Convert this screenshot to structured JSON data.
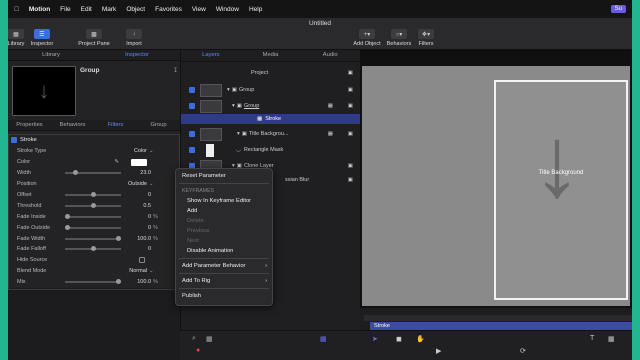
{
  "menubar": {
    "app": "Motion",
    "items": [
      "File",
      "Edit",
      "Mark",
      "Object",
      "Favorites",
      "View",
      "Window",
      "Help"
    ],
    "badge": "Su"
  },
  "window": {
    "title": "Untitled"
  },
  "toolbar": {
    "library": "Library",
    "inspector": "Inspector",
    "project_pane": "Project Pane",
    "import": "Import",
    "add_object": "Add Object",
    "behaviors": "Behaviors",
    "filters": "Filters"
  },
  "left_tabs": {
    "library": "Library",
    "inspector": "Inspector"
  },
  "inspector": {
    "name": "Group",
    "tabs": [
      "Properties",
      "Behaviors",
      "Filters",
      "Group"
    ]
  },
  "stroke": {
    "title": "Stroke",
    "rows": [
      {
        "label": "Stroke Type",
        "value": "Color",
        "unit": ""
      },
      {
        "label": "Color",
        "value": "",
        "unit": ""
      },
      {
        "label": "Width",
        "value": "23.0",
        "unit": ""
      },
      {
        "label": "Position",
        "value": "Outside",
        "unit": ""
      },
      {
        "label": "Offset",
        "value": "0",
        "unit": ""
      },
      {
        "label": "Threshold",
        "value": "0.5",
        "unit": ""
      },
      {
        "label": "Fade Inside",
        "value": "0",
        "unit": "%"
      },
      {
        "label": "Fade Outside",
        "value": "0",
        "unit": "%"
      },
      {
        "label": "Fade Width",
        "value": "100.0",
        "unit": "%"
      },
      {
        "label": "Fade Falloff",
        "value": "0",
        "unit": ""
      },
      {
        "label": "Hide Source",
        "value": "",
        "unit": ""
      },
      {
        "label": "Blend Mode",
        "value": "Normal",
        "unit": ""
      },
      {
        "label": "Mix",
        "value": "100.0",
        "unit": "%"
      }
    ]
  },
  "layer_tabs": {
    "layers": "Layers",
    "media": "Media",
    "audio": "Audio"
  },
  "layers": {
    "project": "Project",
    "group": "Group",
    "group2": "Group",
    "stroke": "Stroke",
    "title_bg": "Title Backgrou...",
    "rect_mask": "Rectangle Mask",
    "clone": "Clone Layer",
    "gauss": "ssian Blur"
  },
  "context_menu": {
    "reset": "Reset Parameter",
    "keyframes": "KEYFRAMES",
    "show_kf": "Show In Keyframe Editor",
    "add": "Add",
    "delete": "Delete",
    "previous": "Previous",
    "next": "Next",
    "disable": "Disable Animation",
    "add_param_behavior": "Add Parameter Behavior",
    "add_to_rig": "Add To Rig",
    "publish": "Publish"
  },
  "canvas": {
    "title": "Title Background"
  },
  "timeline": {
    "track": "Stroke"
  }
}
